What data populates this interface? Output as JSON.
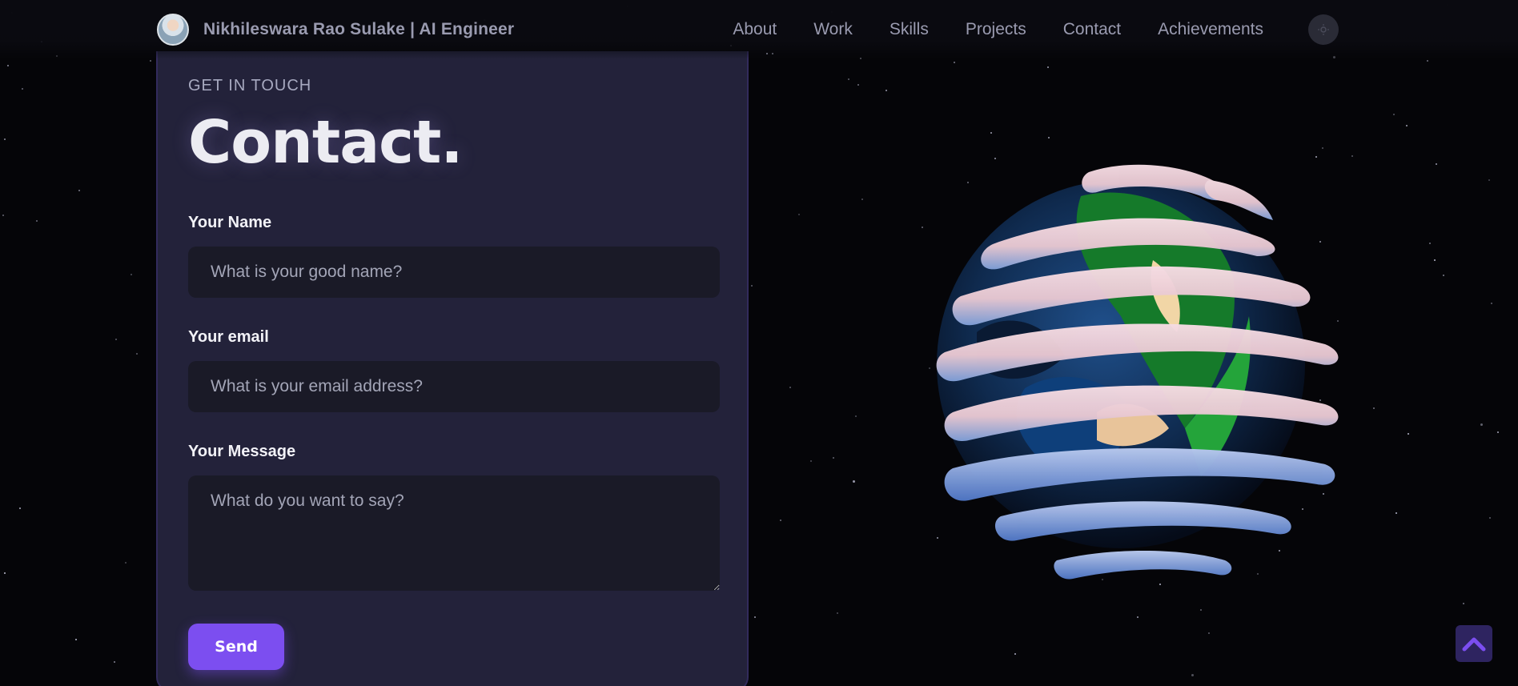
{
  "brand": {
    "name": "Nikhileswara Rao Sulake  | AI Engineer"
  },
  "nav": {
    "links": [
      "About",
      "Work",
      "Skills",
      "Projects",
      "Contact",
      "Achievements"
    ]
  },
  "contact": {
    "eyebrow": "Get in touch",
    "title": "Contact.",
    "name_label": "Your Name",
    "name_placeholder": "What is your good name?",
    "email_label": "Your email",
    "email_placeholder": "What is your email address?",
    "message_label": "Your Message",
    "message_placeholder": "What do you want to say?",
    "send_label": "Send"
  },
  "icons": {
    "theme_toggle": "sun-icon",
    "scroll_top": "chevron-up-icon",
    "globe": "earth-globe-icon"
  },
  "colors": {
    "accent": "#7c4ef0",
    "card_bg": "#23223a",
    "input_bg": "#1a1a27",
    "nav_text": "#9a9bb0"
  }
}
